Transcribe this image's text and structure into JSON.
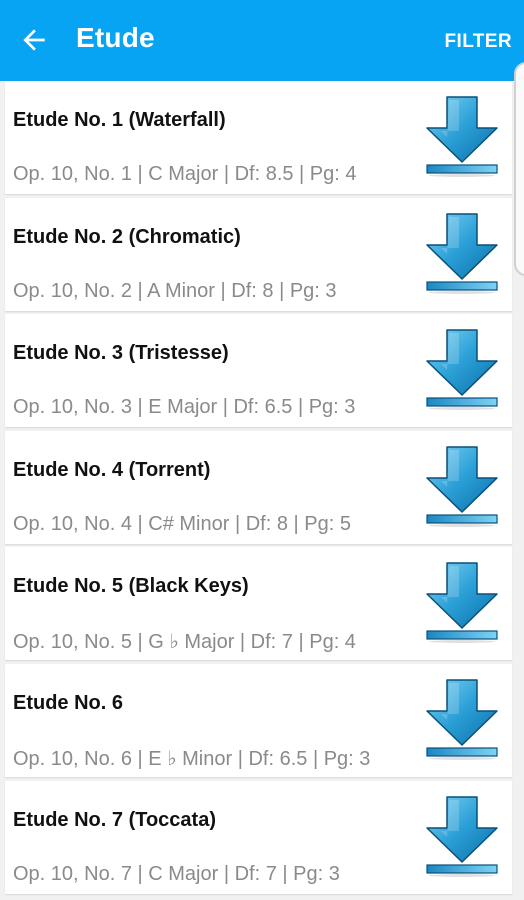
{
  "header": {
    "title": "Etude",
    "filter_label": "FILTER",
    "back_icon": "arrow-left-icon",
    "bg_color": "#08a4f4"
  },
  "items": [
    {
      "title": "Etude No. 1 (Waterfall)",
      "subtitle": "Op. 10, No. 1 | C Major | Df: 8.5 | Pg: 4",
      "icon": "download-icon"
    },
    {
      "title": "Etude No. 2 (Chromatic)",
      "subtitle": "Op. 10, No. 2 | A Minor | Df: 8 | Pg: 3",
      "icon": "download-icon"
    },
    {
      "title": "Etude No. 3 (Tristesse)",
      "subtitle": "Op. 10, No. 3 | E Major | Df: 6.5 | Pg: 3",
      "icon": "download-icon"
    },
    {
      "title": "Etude No. 4 (Torrent)",
      "subtitle": "Op. 10, No. 4 | C# Minor | Df: 8 | Pg: 5",
      "icon": "download-icon"
    },
    {
      "title": "Etude No. 5 (Black Keys)",
      "subtitle": "Op. 10, No. 5 | G ♭ Major | Df: 7 | Pg: 4",
      "icon": "download-icon"
    },
    {
      "title": "Etude No. 6",
      "subtitle": "Op. 10, No. 6 | E ♭ Minor | Df: 6.5 | Pg: 3",
      "icon": "download-icon"
    },
    {
      "title": "Etude No. 7 (Toccata)",
      "subtitle": "Op. 10, No. 7 | C Major | Df: 7 | Pg: 3",
      "icon": "download-icon"
    }
  ]
}
